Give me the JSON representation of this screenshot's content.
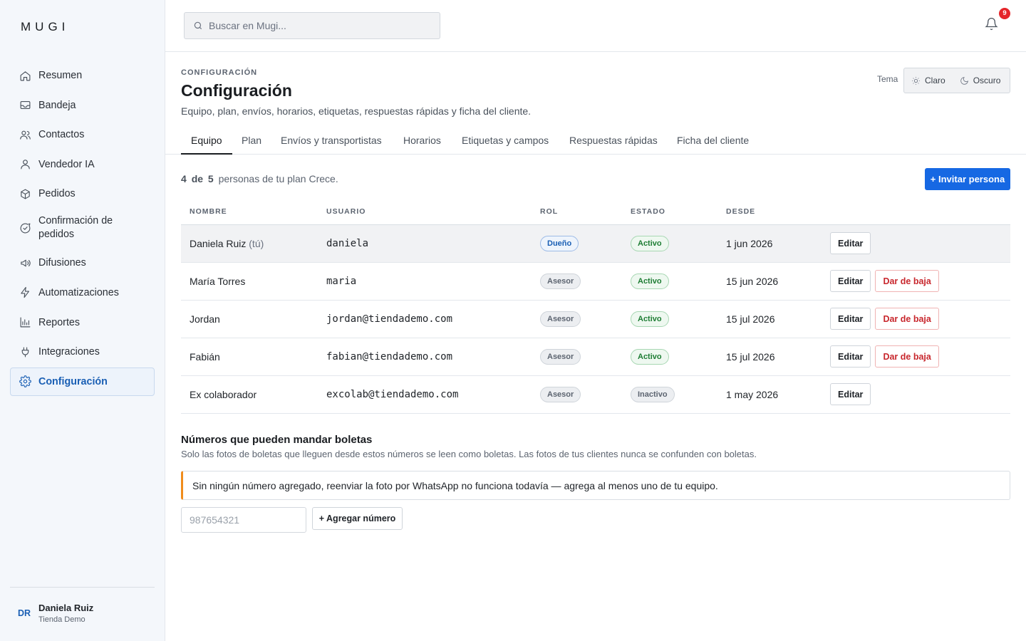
{
  "app": {
    "logo": "MUGI"
  },
  "sidebar": {
    "items": [
      {
        "label": "Resumen",
        "icon": "home-icon"
      },
      {
        "label": "Bandeja",
        "icon": "inbox-icon"
      },
      {
        "label": "Contactos",
        "icon": "contacts-icon"
      },
      {
        "label": "Vendedor IA",
        "icon": "user-icon"
      },
      {
        "label": "Pedidos",
        "icon": "box-icon"
      },
      {
        "label": "Confirmación de pedidos",
        "icon": "chat-check-icon"
      },
      {
        "label": "Difusiones",
        "icon": "megaphone-icon"
      },
      {
        "label": "Automatizaciones",
        "icon": "bolt-icon"
      },
      {
        "label": "Reportes",
        "icon": "bar-chart-icon"
      },
      {
        "label": "Integraciones",
        "icon": "plug-icon"
      },
      {
        "label": "Configuración",
        "icon": "gear-icon",
        "active": true
      }
    ],
    "user": {
      "initials": "DR",
      "name": "Daniela Ruiz",
      "store": "Tienda Demo"
    }
  },
  "header": {
    "search_placeholder": "Buscar en Mugi...",
    "notifications_count": "9"
  },
  "page": {
    "kicker": "CONFIGURACIÓN",
    "title": "Configuración",
    "subtitle": "Equipo, plan, envíos, horarios, etiquetas, respuestas rápidas y ficha del cliente.",
    "theme": {
      "label": "Tema",
      "light": "Claro",
      "dark": "Oscuro"
    }
  },
  "tabs": [
    "Equipo",
    "Plan",
    "Envíos y transportistas",
    "Horarios",
    "Etiquetas y campos",
    "Respuestas rápidas",
    "Ficha del cliente"
  ],
  "team": {
    "quota_used": "4",
    "quota_of": "de",
    "quota_total": "5",
    "quota_text": "personas de tu plan Crece.",
    "invite_label": "+ Invitar persona",
    "columns": [
      "NOMBRE",
      "USUARIO",
      "ROL",
      "ESTADO",
      "DESDE"
    ],
    "rows": [
      {
        "name": "Daniela Ruiz",
        "you": "(tú)",
        "username": "daniela",
        "role": "Dueño",
        "status": "Activo",
        "since": "1 jun 2026",
        "edit": "Editar"
      },
      {
        "name": "María Torres",
        "username": "maria",
        "role": "Asesor",
        "status": "Activo",
        "since": "15 jun 2026",
        "edit": "Editar",
        "remove": "Dar de baja"
      },
      {
        "name": "Jordan",
        "username": "jordan@tiendademo.com",
        "role": "Asesor",
        "status": "Activo",
        "since": "15 jul 2026",
        "edit": "Editar",
        "remove": "Dar de baja"
      },
      {
        "name": "Fabián",
        "username": "fabian@tiendademo.com",
        "role": "Asesor",
        "status": "Activo",
        "since": "15 jul 2026",
        "edit": "Editar",
        "remove": "Dar de baja"
      },
      {
        "name": "Ex colaborador",
        "username": "excolab@tiendademo.com",
        "role": "Asesor",
        "status": "Inactivo",
        "since": "1 may 2026",
        "edit": "Editar"
      }
    ]
  },
  "boletas": {
    "title": "Números que pueden mandar boletas",
    "subtitle": "Solo las fotos de boletas que lleguen desde estos números se leen como boletas. Las fotos de tus clientes nunca se confunden con boletas.",
    "warning": "Sin ningún número agregado, reenviar la foto por WhatsApp no funciona todavía — agrega al menos uno de tu equipo.",
    "input_placeholder": "987654321",
    "add_label": "+ Agregar número"
  },
  "colors": {
    "accent": "#1668e3",
    "active_nav": "#1a5fb4",
    "warning": "#f08c1c",
    "danger": "#c8272d",
    "success": "#1e7d34"
  }
}
